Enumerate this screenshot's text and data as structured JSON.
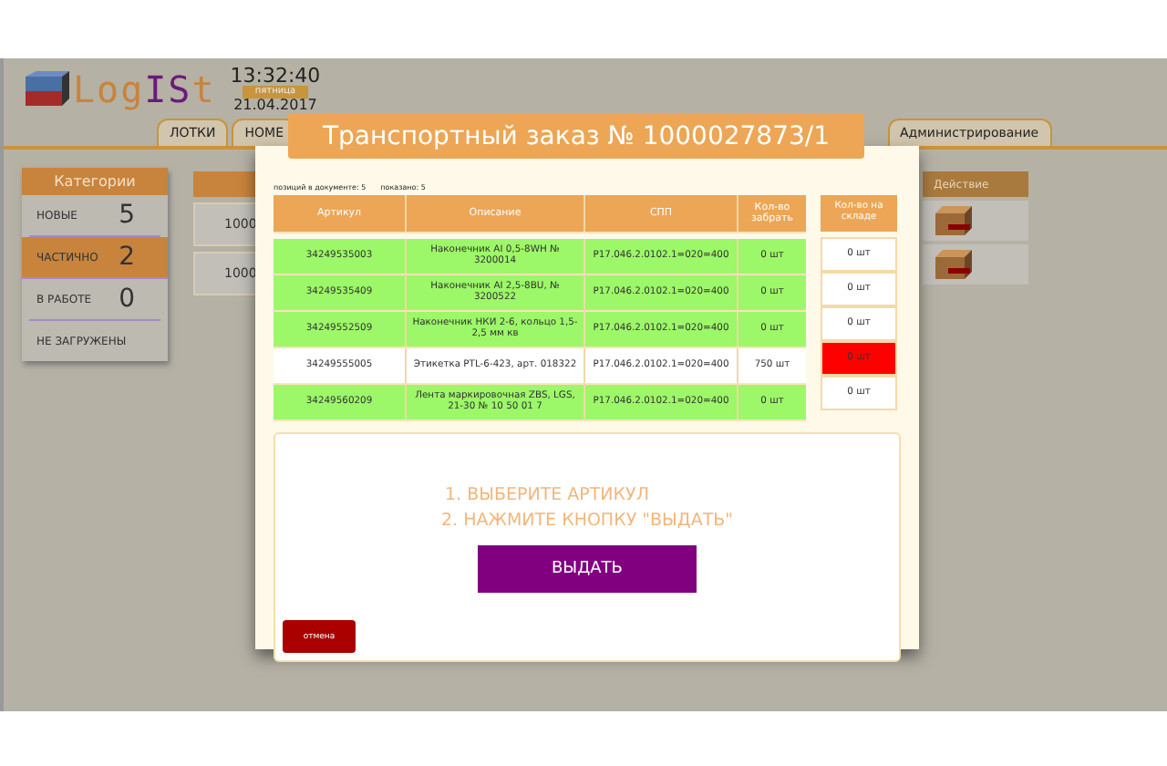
{
  "logo": [
    {
      "text": "Log",
      "accent": false
    },
    {
      "text": "IS",
      "accent": true
    },
    {
      "text": "t",
      "accent": false
    }
  ],
  "clock": {
    "time": "13:32:40",
    "weekday": "пятница",
    "date": "21.04.2017"
  },
  "tabs": [
    {
      "label": "ЛОТКИ",
      "selected": false
    },
    {
      "label": "НОМЕ",
      "selected": false
    },
    {
      "label": "Администрирование",
      "selected": false
    }
  ],
  "categories": {
    "title": "Категории",
    "items": [
      {
        "label": "НОВЫЕ",
        "count": "5",
        "selected": false
      },
      {
        "label": "ЧАСТИЧНО",
        "count": "2",
        "selected": true
      },
      {
        "label": "В РАБОТЕ",
        "count": "0",
        "selected": false
      },
      {
        "label": "НЕ ЗАГРУЖЕНЫ",
        "selected": false
      }
    ]
  },
  "orders_table": {
    "rows": [
      "1000",
      "1000"
    ]
  },
  "action_column": {
    "title": "Действие",
    "rows": [
      {
        "kind": "box"
      },
      {
        "kind": "box"
      }
    ]
  },
  "dialog": {
    "title": "Транспортный заказ № 1000027873/1",
    "positions": "позиций в документе: 5",
    "shown": "показано: 5",
    "columns": [
      "Артикул",
      "Описание",
      "СПП",
      "Кол-во забрать"
    ],
    "stock_column": "Кол-во на складе",
    "rows": [
      {
        "article": "34249535003",
        "description": "Наконечник AI 0,5-8WH № 3200014",
        "spp": "P17.046.2.0102.1=020=400",
        "to_pick": "0 шт",
        "stock": "0 шт",
        "done": true,
        "in_stock": true
      },
      {
        "article": "34249535409",
        "description": "Наконечник AI 2,5-8BU, № 3200522",
        "spp": "P17.046.2.0102.1=020=400",
        "to_pick": "0 шт",
        "stock": "0 шт",
        "done": true,
        "in_stock": true
      },
      {
        "article": "34249552509",
        "description": "Наконечник НКИ 2-6, кольцо 1,5-2,5 мм кв",
        "spp": "P17.046.2.0102.1=020=400",
        "to_pick": "0 шт",
        "stock": "0 шт",
        "done": true,
        "in_stock": true
      },
      {
        "article": "34249555005",
        "description": "Этикетка PTL-6-423, арт. 018322",
        "spp": "P17.046.2.0102.1=020=400",
        "to_pick": "750 шт",
        "stock": "0 шт",
        "done": false,
        "in_stock": false
      },
      {
        "article": "34249560209",
        "description": "Лента маркировочная ZBS, LGS, 21-30 № 10 50 01 7",
        "spp": "P17.046.2.0102.1=020=400",
        "to_pick": "0 шт",
        "stock": "0 шт",
        "done": true,
        "in_stock": true
      }
    ],
    "instructions": [
      "1. ВЫБЕРИТЕ АРТИКУЛ",
      "2. НАЖМИТЕ КНОПКУ \"ВЫДАТЬ\""
    ],
    "issue_button": "ВЫДАТЬ",
    "cancel_button": "отмена"
  }
}
